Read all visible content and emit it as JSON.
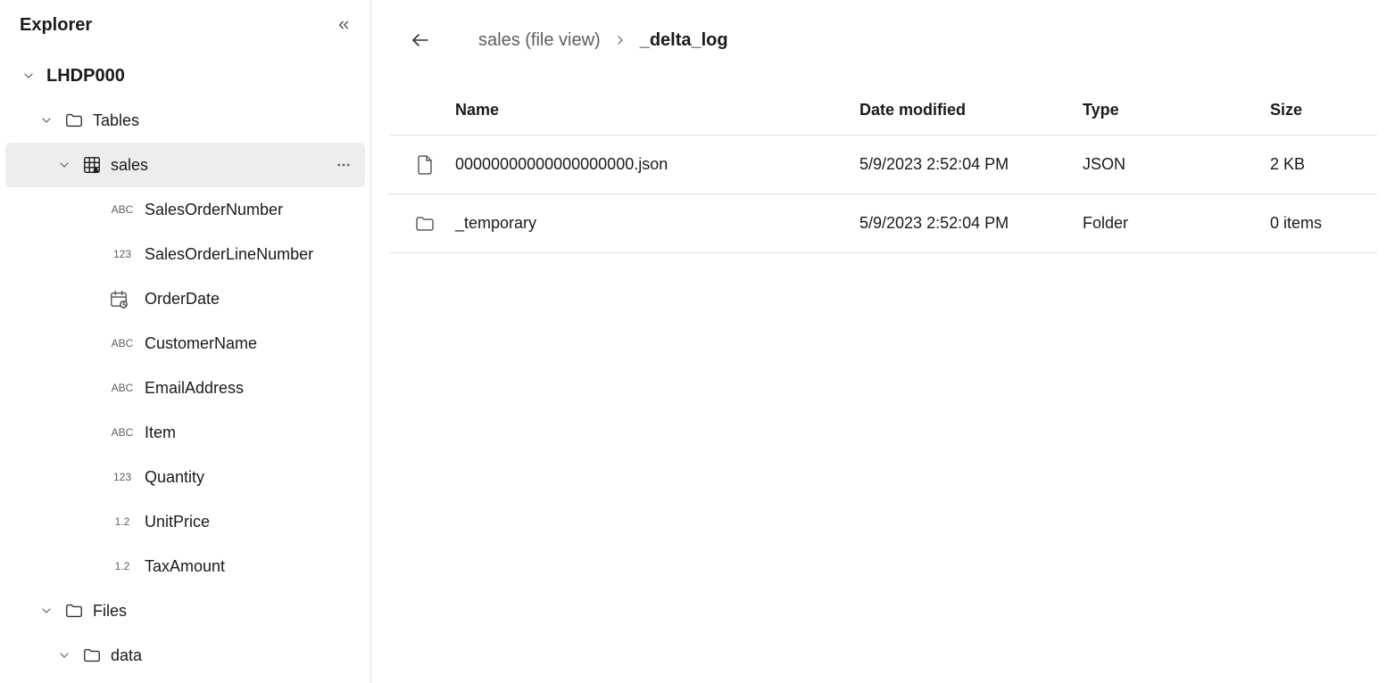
{
  "sidebar": {
    "title": "Explorer",
    "root": {
      "label": "LHDP000"
    },
    "tables_label": "Tables",
    "sales_label": "sales",
    "files_label": "Files",
    "data_label": "data",
    "columns": [
      {
        "type": "ABC",
        "label": "SalesOrderNumber"
      },
      {
        "type": "123",
        "label": "SalesOrderLineNumber"
      },
      {
        "type": "DATE",
        "label": "OrderDate"
      },
      {
        "type": "ABC",
        "label": "CustomerName"
      },
      {
        "type": "ABC",
        "label": "EmailAddress"
      },
      {
        "type": "ABC",
        "label": "Item"
      },
      {
        "type": "123",
        "label": "Quantity"
      },
      {
        "type": "1.2",
        "label": "UnitPrice"
      },
      {
        "type": "1.2",
        "label": "TaxAmount"
      }
    ]
  },
  "breadcrumb": {
    "parent": "sales (file view)",
    "current": "_delta_log"
  },
  "table": {
    "headers": {
      "name": "Name",
      "date": "Date modified",
      "type": "Type",
      "size": "Size"
    },
    "rows": [
      {
        "icon": "file",
        "name": "00000000000000000000.json",
        "date": "5/9/2023 2:52:04 PM",
        "type": "JSON",
        "size": "2 KB"
      },
      {
        "icon": "folder",
        "name": "_temporary",
        "date": "5/9/2023 2:52:04 PM",
        "type": "Folder",
        "size": "0 items"
      }
    ]
  }
}
